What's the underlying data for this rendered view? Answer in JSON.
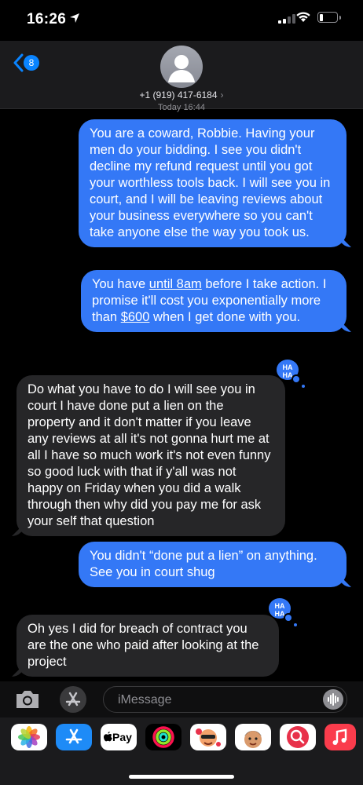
{
  "status_bar": {
    "time": "16:26"
  },
  "header": {
    "back_count": "8",
    "contact": "+1 (919) 417-6184",
    "chevron": "›",
    "timestamp": "Today 16:44"
  },
  "messages": [
    {
      "dir": "out",
      "text": "You are a coward, Robbie. Having your men do your bidding. I see you didn't decline my refund request until you got your worthless tools back. I will see you in court, and I will be leaving reviews about your business everywhere so you can't take anyone else the way you took us."
    },
    {
      "dir": "out",
      "parts": [
        "You have ",
        "until 8am",
        " before I take action. I promise it'll cost you exponentially more than ",
        "$600",
        " when I get done with you."
      ]
    },
    {
      "dir": "in",
      "text": "Do what you have to do I will see you in court I have done put a lien on the property and it don't matter if you leave any reviews at all it's not gonna hurt me at all I have so much work it's not even funny so good luck with that if y'all was not happy on Friday when you did a walk through then why did you pay me for ask your self that question",
      "tapback": "HA HA"
    },
    {
      "dir": "out",
      "text": "You didn't “done put a lien” on anything. See you in court shug"
    },
    {
      "dir": "in",
      "text": "Oh yes I did for breach of contract you are the one who paid after looking at the project",
      "tapback": "HA HA"
    }
  ],
  "compose": {
    "placeholder": "iMessage"
  },
  "app_tray": [
    {
      "name": "photos",
      "color": "#ffffff"
    },
    {
      "name": "app-store",
      "color": "#1e8bf7"
    },
    {
      "name": "apple-pay",
      "label": "Pay",
      "color": "#ffffff"
    },
    {
      "name": "fitness",
      "color": "#000000"
    },
    {
      "name": "memoji-stickers",
      "color": "#ffffff"
    },
    {
      "name": "memoji-2",
      "color": "#ffffff"
    },
    {
      "name": "web-search",
      "color": "#e8314a"
    },
    {
      "name": "music",
      "color": "#fa3c4c"
    }
  ],
  "colors": {
    "outgoing": "#3478f6",
    "incoming": "#262628",
    "badge": "#0a84ff"
  }
}
